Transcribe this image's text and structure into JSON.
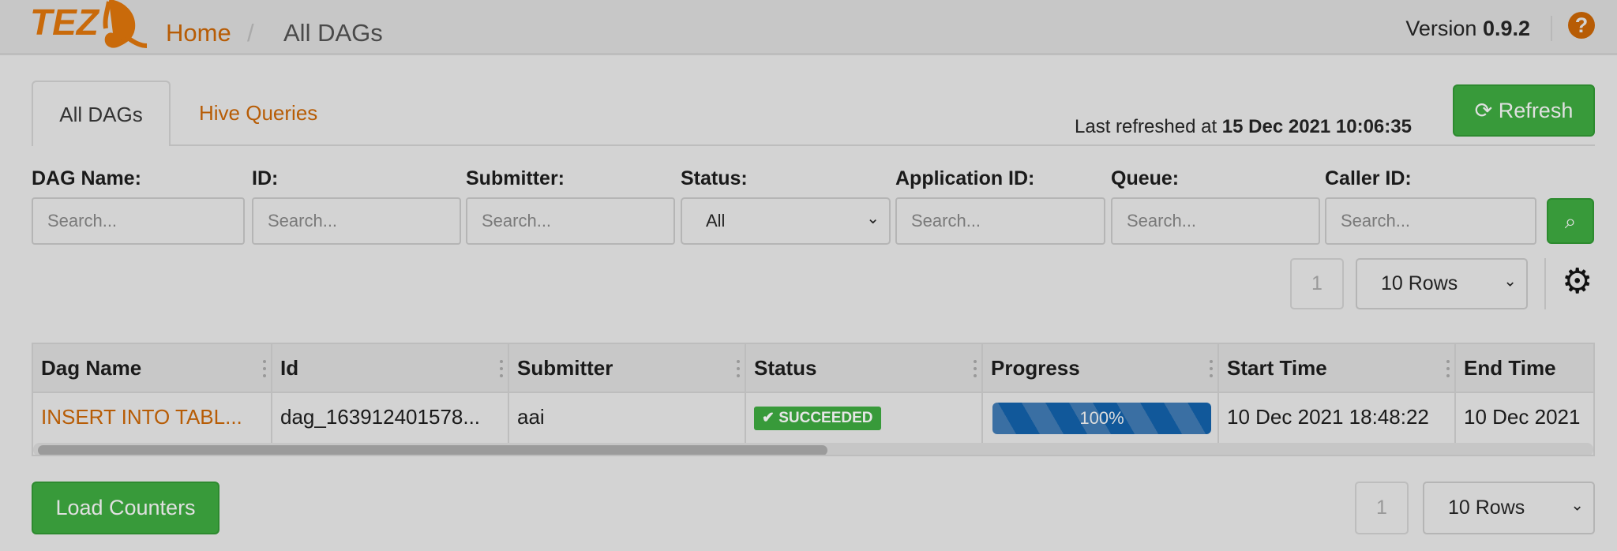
{
  "header": {
    "logo_text": "TEZ",
    "home": "Home",
    "separator": "/",
    "current": "All DAGs",
    "version_label": "Version",
    "version": "0.9.2",
    "help_icon": "question-circle-icon"
  },
  "tabs": [
    {
      "label": "All DAGs",
      "active": true
    },
    {
      "label": "Hive Queries",
      "active": false
    }
  ],
  "refresh": {
    "last_refreshed_label": "Last refreshed at",
    "last_refreshed": "15 Dec 2021 10:06:35",
    "button": "Refresh",
    "icon": "refresh-icon"
  },
  "filters": [
    {
      "label": "DAG Name:",
      "placeholder": "Search..."
    },
    {
      "label": "ID:",
      "placeholder": "Search..."
    },
    {
      "label": "Submitter:",
      "placeholder": "Search..."
    },
    {
      "label": "Status:",
      "value": "All"
    },
    {
      "label": "Application ID:",
      "placeholder": "Search..."
    },
    {
      "label": "Queue:",
      "placeholder": "Search..."
    },
    {
      "label": "Caller ID:",
      "placeholder": "Search..."
    }
  ],
  "pagination": {
    "page": "1",
    "rows": "10 Rows"
  },
  "table": {
    "columns": [
      "Dag Name",
      "Id",
      "Submitter",
      "Status",
      "Progress",
      "Start Time",
      "End Time"
    ],
    "rows": [
      {
        "dag_name": "INSERT INTO TABL...",
        "id": "dag_163912401578...",
        "submitter": "aai",
        "status": "SUCCEEDED",
        "progress": "100%",
        "progress_value": 100,
        "start_time": "10 Dec 2021 18:48:22",
        "end_time": "10 Dec 2021"
      }
    ]
  },
  "footer": {
    "load_counters": "Load Counters",
    "page": "1",
    "rows": "10 Rows"
  },
  "colors": {
    "accent": "#b75c05",
    "success": "#389a3a",
    "progress": "#11589a"
  }
}
